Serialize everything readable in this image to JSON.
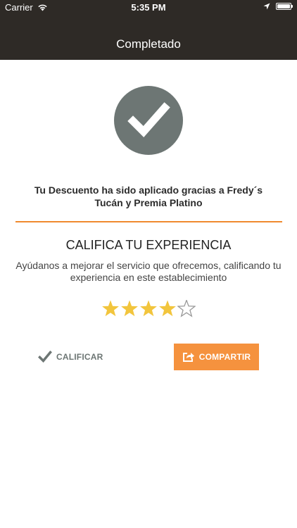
{
  "status_bar": {
    "carrier": "Carrier",
    "time": "5:35 PM",
    "battery_level": 1.0
  },
  "nav": {
    "title": "Completado"
  },
  "result": {
    "message": "Tu Descuento ha sido aplicado gracias a Fredy´s Tucán y Premia Platino"
  },
  "rating": {
    "title": "CALIFICA TU EXPERIENCIA",
    "subtitle": "Ayúdanos a mejorar el servicio que ofrecemos, calificando tu experiencia en este establecimiento",
    "stars_filled": 4,
    "stars_total": 5
  },
  "actions": {
    "rate_label": "CALIFICAR",
    "share_label": "COMPARTIR"
  },
  "colors": {
    "header_bg": "#2e2a26",
    "accent": "#f5923e",
    "divider": "#f08a2e",
    "check_circle": "#6d7674",
    "star_filled": "#f2c53d",
    "star_empty": "#999999"
  }
}
